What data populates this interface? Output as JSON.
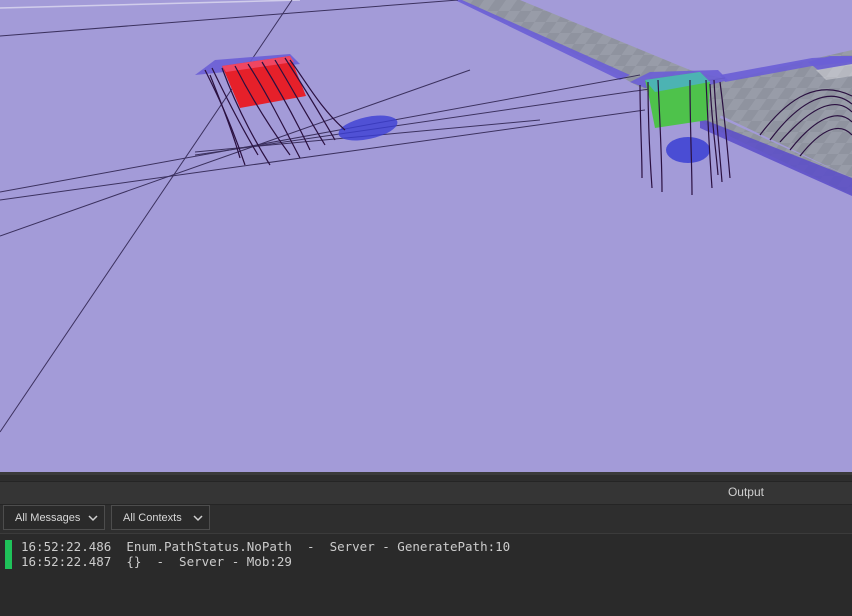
{
  "viewport": {
    "scene": "3d-viewport",
    "colors": {
      "floor": "#a39bd8",
      "baseplate": "#8f939f",
      "navmesh_edge": "#5a4cc9",
      "red_part": "#e6202a",
      "green_part": "#4ec24b",
      "shadow": "#3b3fd4"
    }
  },
  "output": {
    "title": "Output",
    "filters": {
      "messages": "All Messages",
      "contexts": "All Contexts"
    },
    "log": [
      {
        "time": "16:52:22.486",
        "text": "Enum.PathStatus.NoPath  -  Server - GeneratePath:10"
      },
      {
        "time": "16:52:22.487",
        "text": "{}  -  Server - Mob:29"
      }
    ],
    "colors": {
      "marker": "#1fc25a",
      "text": "#cccccc"
    }
  }
}
